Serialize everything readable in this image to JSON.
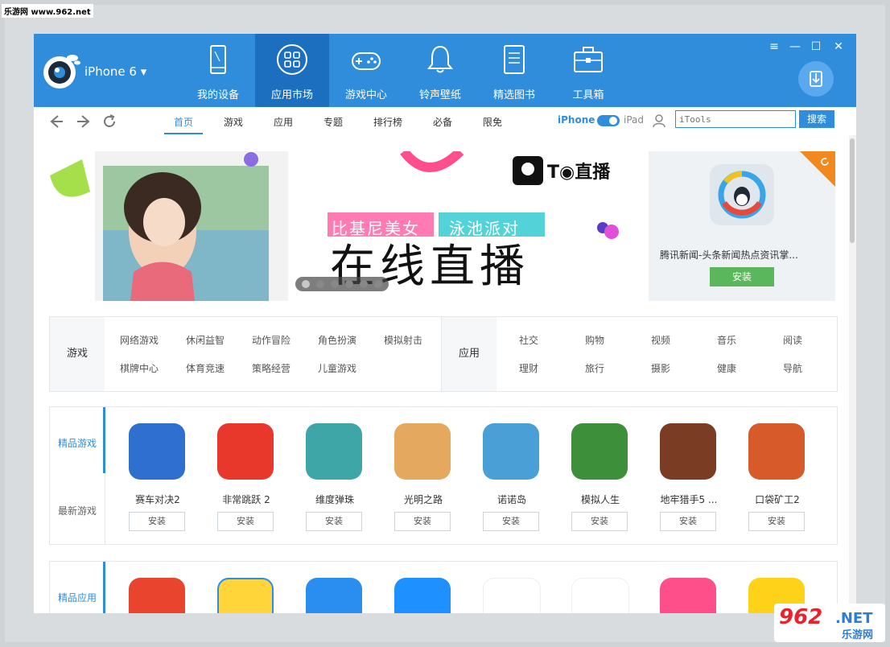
{
  "watermark": {
    "top_text": "乐游网 www.962.net",
    "logo_big": "962",
    "logo_net": ".NET",
    "logo_cn": "乐游网"
  },
  "device": {
    "name": "iPhone 6 ▾"
  },
  "nav_tabs": [
    {
      "label": "我的设备",
      "icon": "tablet-icon"
    },
    {
      "label": "应用市场",
      "icon": "grid-apps-icon"
    },
    {
      "label": "游戏中心",
      "icon": "gamepad-icon"
    },
    {
      "label": "铃声壁纸",
      "icon": "bell-icon"
    },
    {
      "label": "精选图书",
      "icon": "book-icon"
    },
    {
      "label": "工具箱",
      "icon": "toolbox-icon"
    }
  ],
  "window_controls": {
    "menu": "≡",
    "minimize": "—",
    "maximize": "☐",
    "close": "✕"
  },
  "subnav": {
    "tabs": [
      "首页",
      "游戏",
      "应用",
      "专题",
      "排行榜",
      "必备",
      "限免"
    ],
    "device_toggle": {
      "left": "iPhone",
      "right": "iPad"
    },
    "search_placeholder": "iTools",
    "search_button": "搜索"
  },
  "banner": {
    "brand": "T◉直播",
    "tag1": "比基尼美女",
    "tag2": "泳池派对",
    "headline": "在线直播",
    "dots": 6,
    "active_dot": 0
  },
  "side_ad": {
    "name": "腾讯新闻-头条新闻热点资讯掌...",
    "button": "安装"
  },
  "categories": {
    "games": {
      "title": "游戏",
      "items": [
        "网络游戏",
        "休闲益智",
        "动作冒险",
        "角色扮演",
        "模拟射击",
        "棋牌中心",
        "体育竞速",
        "策略经营",
        "儿童游戏"
      ]
    },
    "apps": {
      "title": "应用",
      "items": [
        "社交",
        "购物",
        "视频",
        "音乐",
        "阅读",
        "理财",
        "旅行",
        "摄影",
        "健康",
        "导航"
      ]
    }
  },
  "games_section": {
    "links": [
      "精品游戏",
      "最新游戏"
    ],
    "apps": [
      {
        "name": "赛车对决2",
        "button": "安装",
        "color": "#2f6fd0"
      },
      {
        "name": "非常跳跃 2",
        "button": "安装",
        "color": "#e8382c"
      },
      {
        "name": "维度弹珠",
        "button": "安装",
        "color": "#3fa6a8"
      },
      {
        "name": "光明之路",
        "button": "安装",
        "color": "#e4a85e"
      },
      {
        "name": "诺诺岛",
        "button": "安装",
        "color": "#4aa0d6"
      },
      {
        "name": "模拟人生",
        "button": "安装",
        "color": "#3e8f3a"
      },
      {
        "name": "地牢猎手5 ...",
        "button": "安装",
        "color": "#7a3d24"
      },
      {
        "name": "口袋矿工2",
        "button": "安装",
        "color": "#d65a2a"
      }
    ]
  },
  "apps_section": {
    "links": [
      "精品应用"
    ],
    "apps": [
      {
        "color": "#e8442e"
      },
      {
        "color": "#ffd53a"
      },
      {
        "color": "#2a8ef0"
      },
      {
        "color": "#1e90ff"
      },
      {
        "color": "#ffffff"
      },
      {
        "color": "#ffffff"
      },
      {
        "color": "#ff4f8b"
      },
      {
        "color": "#ffd21a"
      }
    ]
  }
}
